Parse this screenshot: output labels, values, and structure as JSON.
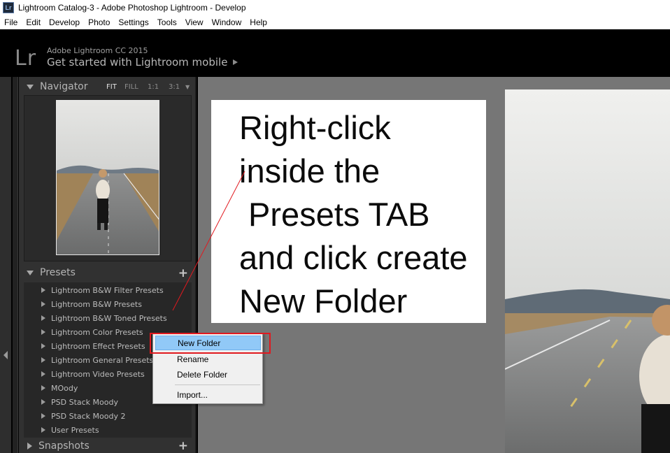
{
  "window": {
    "app_icon": "Lr",
    "title": "Lightroom Catalog-3 - Adobe Photoshop Lightroom - Develop"
  },
  "menu": [
    "File",
    "Edit",
    "Develop",
    "Photo",
    "Settings",
    "Tools",
    "View",
    "Window",
    "Help"
  ],
  "identity_plate": {
    "logo": "Lr",
    "product": "Adobe Lightroom CC 2015",
    "tagline": "Get started with Lightroom mobile"
  },
  "navigator": {
    "title": "Navigator",
    "zoom": [
      "FIT",
      "FILL",
      "1:1",
      "3:1"
    ],
    "active_zoom": "FIT"
  },
  "presets": {
    "title": "Presets",
    "add_label": "+",
    "items": [
      "Lightroom B&W Filter Presets",
      "Lightroom B&W Presets",
      "Lightroom B&W Toned Presets",
      "Lightroom Color Presets",
      "Lightroom Effect Presets",
      "Lightroom General Presets",
      "Lightroom Video Presets",
      "MOody",
      "PSD Stack Moody",
      "PSD Stack Moody 2",
      "User Presets"
    ]
  },
  "snapshots": {
    "title": "Snapshots",
    "add_label": "+"
  },
  "context_menu": {
    "items": [
      "New Folder",
      "Rename",
      "Delete Folder",
      "Import..."
    ],
    "highlighted": "New Folder"
  },
  "annotation": {
    "lines": [
      "Right-click",
      "inside the",
      " Presets TAB",
      "and click create",
      "New Folder"
    ]
  },
  "colors": {
    "highlight": "#91c9f7",
    "annotation_red": "#e1191f",
    "panel_bg": "#313131",
    "center_bg": "#767676"
  }
}
